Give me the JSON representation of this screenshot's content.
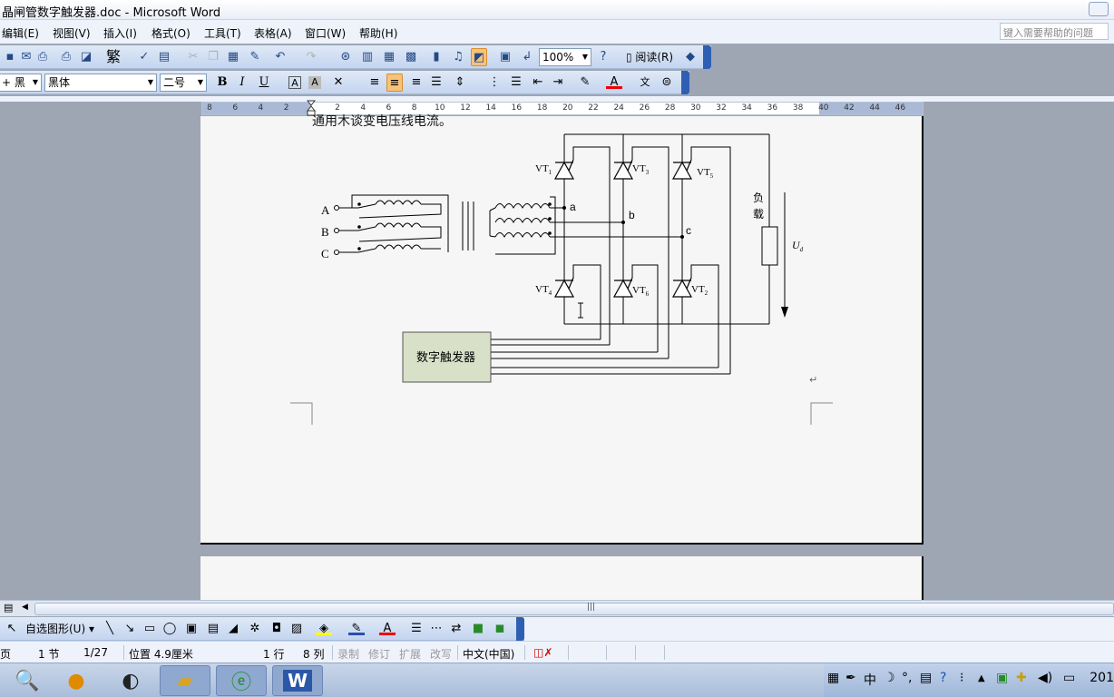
{
  "window": {
    "title": "晶闸管数字触发器.doc - Microsoft Word"
  },
  "menu": {
    "items": [
      "编辑(E)",
      "视图(V)",
      "插入(I)",
      "格式(O)",
      "工具(T)",
      "表格(A)",
      "窗口(W)",
      "帮助(H)"
    ],
    "help_placeholder": "键入需要帮助的问题"
  },
  "toolbar": {
    "zoom": "100%",
    "traditional": "繁",
    "read_label": "阅读(R)",
    "style": "+ 黑",
    "font": "黑体",
    "size": "二号",
    "bold": "B",
    "italic": "I",
    "underline": "U",
    "char_a": "A",
    "font_color_a": "A",
    "phonetic": "文"
  },
  "ruler": {
    "ticks": [
      "8",
      "6",
      "4",
      "2",
      "",
      "2",
      "4",
      "6",
      "8",
      "10",
      "12",
      "14",
      "16",
      "18",
      "20",
      "22",
      "24",
      "26",
      "28",
      "30",
      "32",
      "34",
      "36",
      "38",
      "40",
      "42",
      "44",
      "46"
    ]
  },
  "document": {
    "cut_text": "通用木谈变电压线电流。",
    "para_mark": "↵",
    "circuit": {
      "phase_labels": [
        "A",
        "B",
        "C"
      ],
      "node_labels": [
        "a",
        "b",
        "c"
      ],
      "thyristors": [
        "VT1",
        "VT3",
        "VT5",
        "VT4",
        "VT6",
        "VT2"
      ],
      "thyristor_main": [
        "VT",
        "VT",
        "VT",
        "VT",
        "VT",
        "VT"
      ],
      "thyristor_sub": [
        "1",
        "3",
        "5",
        "4",
        "6",
        "2"
      ],
      "load_label_1": "负",
      "load_label_2": "载",
      "voltage_main": "U",
      "voltage_sub": "d",
      "trigger_box": "数字触发器"
    }
  },
  "drawing": {
    "autoshapes": "自选图形(U)"
  },
  "status": {
    "page": "页",
    "section": "1 节",
    "pages": "1/27",
    "position": "位置 4.9厘米",
    "line": "1 行",
    "col": "8 列",
    "rec": "录制",
    "trk": "修订",
    "ext": "扩展",
    "ovr": "改写",
    "lang": "中文(中国)"
  },
  "taskbar": {
    "ime": "中",
    "clock": "201"
  },
  "colors": {
    "trigger_fill": "#d8e0c8",
    "accent": "#2f5fb3",
    "active": "#f7c27a"
  }
}
